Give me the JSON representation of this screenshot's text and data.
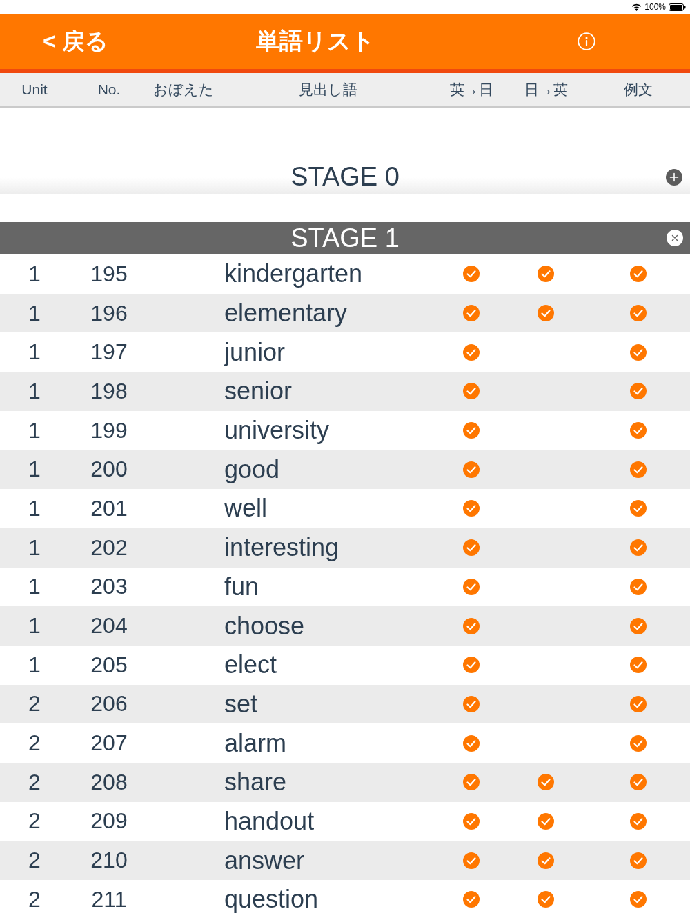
{
  "status_bar": {
    "battery_text": "100%"
  },
  "nav": {
    "back": "< 戻る",
    "title": "単語リスト"
  },
  "columns": [
    "Unit",
    "No.",
    "おぼえた",
    "見出し語",
    "英→日",
    "日→英",
    "例文"
  ],
  "sections": [
    {
      "title": "STAGE 0",
      "expanded": false
    },
    {
      "title": "STAGE 1",
      "expanded": true,
      "rows": [
        {
          "unit": "1",
          "no": "195",
          "word": "kindergarten",
          "en_to_ja": true,
          "ja_to_en": true,
          "example": true
        },
        {
          "unit": "1",
          "no": "196",
          "word": "elementary",
          "en_to_ja": true,
          "ja_to_en": true,
          "example": true
        },
        {
          "unit": "1",
          "no": "197",
          "word": "junior",
          "en_to_ja": true,
          "ja_to_en": false,
          "example": true
        },
        {
          "unit": "1",
          "no": "198",
          "word": "senior",
          "en_to_ja": true,
          "ja_to_en": false,
          "example": true
        },
        {
          "unit": "1",
          "no": "199",
          "word": "university",
          "en_to_ja": true,
          "ja_to_en": false,
          "example": true
        },
        {
          "unit": "1",
          "no": "200",
          "word": "good",
          "en_to_ja": true,
          "ja_to_en": false,
          "example": true
        },
        {
          "unit": "1",
          "no": "201",
          "word": "well",
          "en_to_ja": true,
          "ja_to_en": false,
          "example": true
        },
        {
          "unit": "1",
          "no": "202",
          "word": "interesting",
          "en_to_ja": true,
          "ja_to_en": false,
          "example": true
        },
        {
          "unit": "1",
          "no": "203",
          "word": "fun",
          "en_to_ja": true,
          "ja_to_en": false,
          "example": true
        },
        {
          "unit": "1",
          "no": "204",
          "word": "choose",
          "en_to_ja": true,
          "ja_to_en": false,
          "example": true
        },
        {
          "unit": "1",
          "no": "205",
          "word": "elect",
          "en_to_ja": true,
          "ja_to_en": false,
          "example": true
        },
        {
          "unit": "2",
          "no": "206",
          "word": "set",
          "en_to_ja": true,
          "ja_to_en": false,
          "example": true
        },
        {
          "unit": "2",
          "no": "207",
          "word": "alarm",
          "en_to_ja": true,
          "ja_to_en": false,
          "example": true
        },
        {
          "unit": "2",
          "no": "208",
          "word": "share",
          "en_to_ja": true,
          "ja_to_en": true,
          "example": true
        },
        {
          "unit": "2",
          "no": "209",
          "word": "handout",
          "en_to_ja": true,
          "ja_to_en": true,
          "example": true
        },
        {
          "unit": "2",
          "no": "210",
          "word": "answer",
          "en_to_ja": true,
          "ja_to_en": true,
          "example": true
        },
        {
          "unit": "2",
          "no": "211",
          "word": "question",
          "en_to_ja": true,
          "ja_to_en": true,
          "example": true
        }
      ]
    }
  ]
}
